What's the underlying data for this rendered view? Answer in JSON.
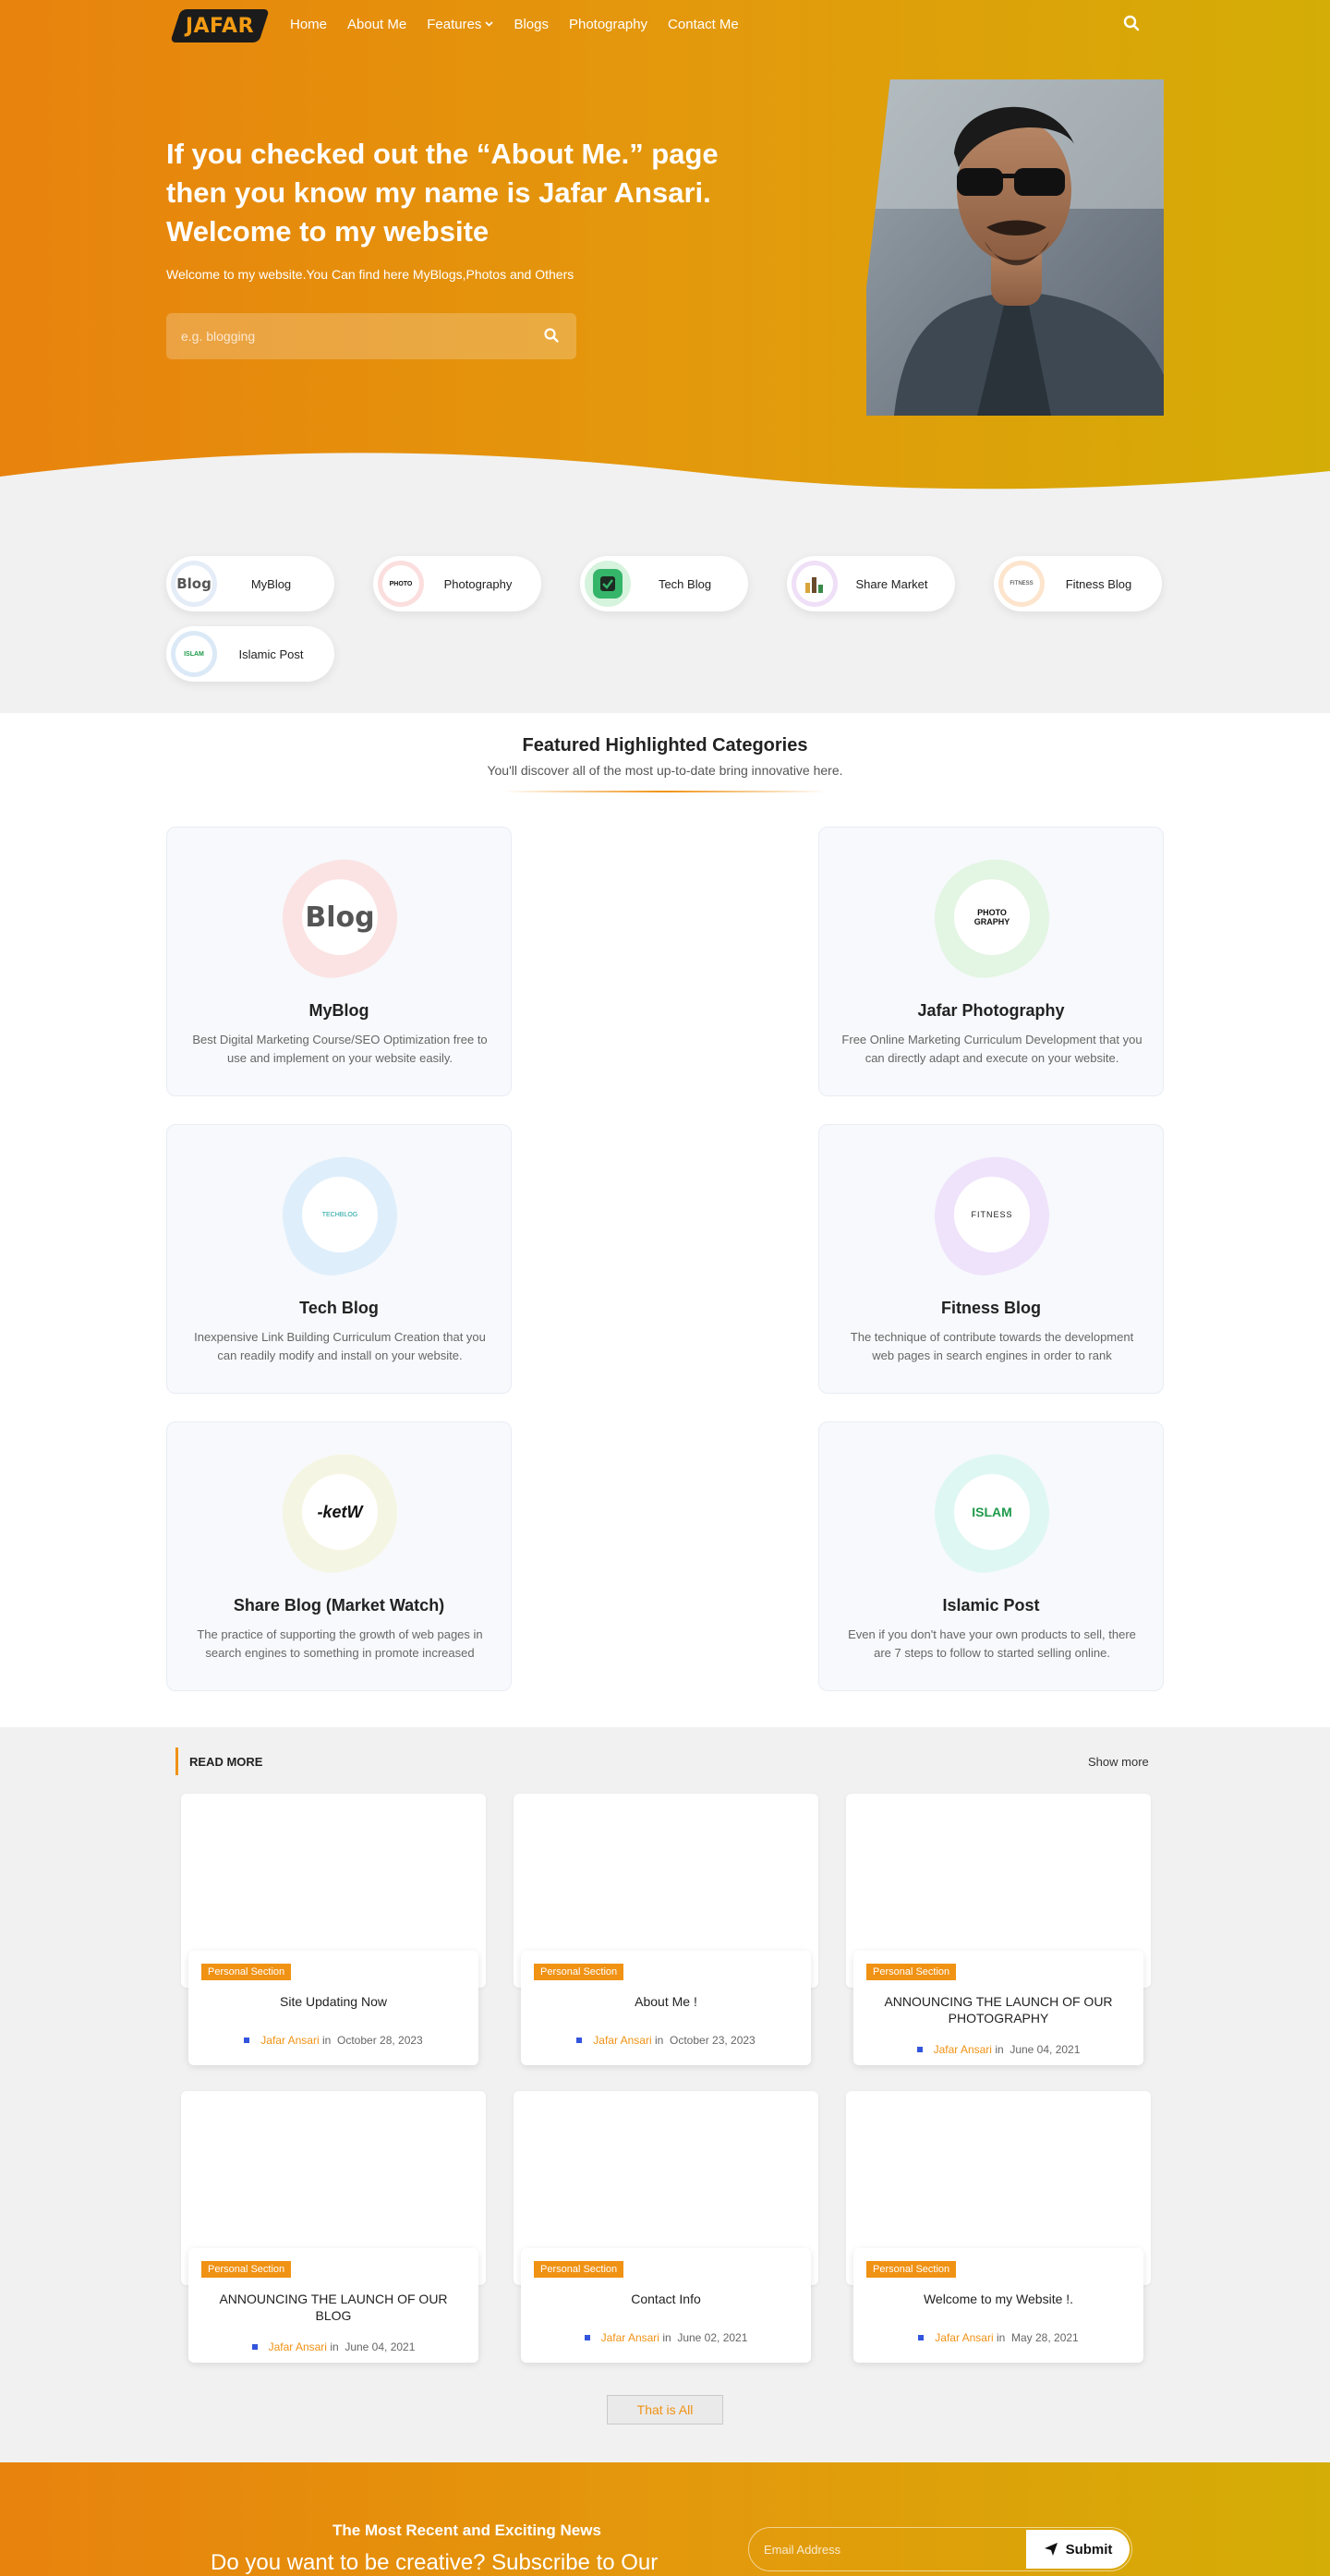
{
  "nav": {
    "logo": "JAFAR",
    "items": [
      "Home",
      "About Me",
      "Features",
      "Blogs",
      "Photography",
      "Contact Me"
    ],
    "features_caret": "⌄"
  },
  "hero": {
    "title": "If you checked out the “About Me.” page then you know my name is Jafar Ansari. Welcome to my website",
    "subtitle": "Welcome to my website.You Can find here MyBlogs,Photos and Others",
    "search_placeholder": "e.g. blogging"
  },
  "chips": [
    {
      "label": "MyBlog",
      "icon_text": "Blog"
    },
    {
      "label": "Photography",
      "icon_text": "PHOTO"
    },
    {
      "label": "Tech Blog",
      "icon_text": "✔"
    },
    {
      "label": "Share Market",
      "icon_text": ""
    },
    {
      "label": "Fitness Blog",
      "icon_text": "FITNESS"
    },
    {
      "label": "Islamic Post",
      "icon_text": "ISLAM"
    }
  ],
  "featured": {
    "title": "Featured Highlighted Categories",
    "subtitle": "You'll discover all of the most up-to-date bring innovative here.",
    "cards": [
      {
        "title": "MyBlog",
        "desc": "Best Digital Marketing Course/SEO Optimization free to use and implement on your website easily.",
        "icon_text": "Blog",
        "blob": "#fbe3e3"
      },
      {
        "title": "Jafar Photography",
        "desc": "Free Online Marketing Curriculum Development that you can directly adapt and execute on your website.",
        "icon_text": "PHOTO GRAPHY",
        "blob": "#e3f5e3"
      },
      {
        "title": "Tech Blog",
        "desc": "Inexpensive Link Building Curriculum Creation that you can readily modify and install on your website.",
        "icon_text": "TECHBLOG",
        "blob": "#dfeefb"
      },
      {
        "title": "Fitness Blog",
        "desc": "The technique of contribute towards the development web pages in search engines in order to rank",
        "icon_text": "FITNESS",
        "blob": "#efe3fb"
      },
      {
        "title": "Share Blog (Market Watch)",
        "desc": "The practice of supporting the growth of web pages in search engines to something in promote increased",
        "icon_text": "-ketW",
        "blob": "#f5f5e3"
      },
      {
        "title": "Islamic Post",
        "desc": "Even if you don't have your own products to sell, there are 7 steps to follow to started selling online.",
        "icon_text": "ISLAM",
        "blob": "#dff7f3"
      }
    ]
  },
  "read_more": {
    "label": "READ MORE",
    "show_more": "Show more",
    "posts": [
      {
        "tag": "Personal Section",
        "title": "Site Updating Now",
        "author": "Jafar Ansari",
        "in": "in",
        "date": "October 28, 2023"
      },
      {
        "tag": "Personal Section",
        "title": "About Me !",
        "author": "Jafar Ansari",
        "in": "in",
        "date": "October 23, 2023"
      },
      {
        "tag": "Personal Section",
        "title": "ANNOUNCING THE LAUNCH OF OUR PHOTOGRAPHY",
        "author": "Jafar Ansari",
        "in": "in",
        "date": "June 04, 2021"
      },
      {
        "tag": "Personal Section",
        "title": "ANNOUNCING THE LAUNCH OF OUR BLOG",
        "author": "Jafar Ansari",
        "in": "in",
        "date": "June 04, 2021"
      },
      {
        "tag": "Personal Section",
        "title": "Contact Info",
        "author": "Jafar Ansari",
        "in": "in",
        "date": "June 02, 2021"
      },
      {
        "tag": "Personal Section",
        "title": "Welcome to my Website !.",
        "author": "Jafar Ansari",
        "in": "in",
        "date": "May 28, 2021"
      }
    ],
    "end_button": "That is All"
  },
  "newsletter": {
    "small": "The Most Recent and Exciting News",
    "big": "Do you want to be creative? Subscribe to Our",
    "email_placeholder": "Email Address",
    "submit": "Submit"
  },
  "colors": {
    "accent": "#f09214",
    "hero_start": "#e8830d",
    "hero_end": "#d4ad06"
  }
}
